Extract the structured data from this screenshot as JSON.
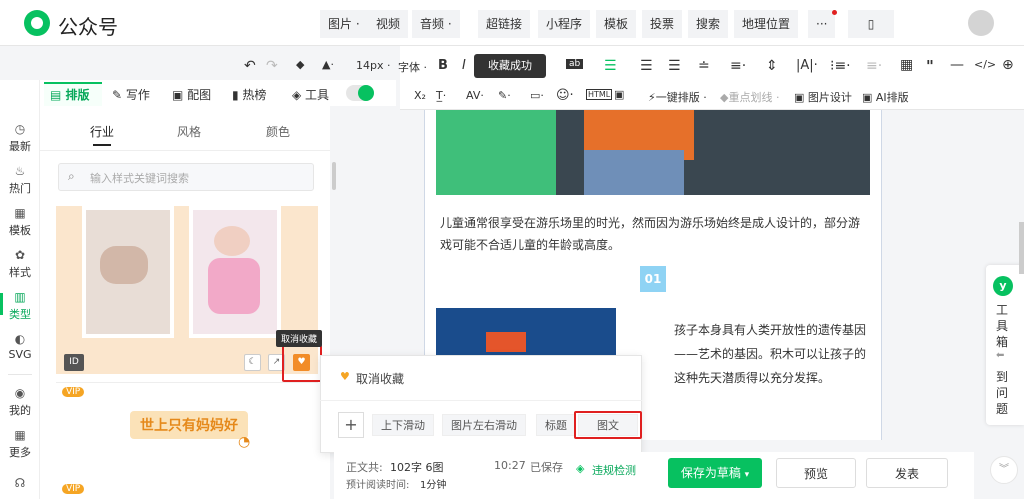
{
  "header": {
    "brand": "公众号"
  },
  "topnav": [
    "图片 ·",
    "视频",
    "音频 ·",
    "超链接",
    "小程序",
    "模板",
    "投票",
    "搜索",
    "地理位置",
    "···"
  ],
  "editor_toolbar": {
    "font_size": "14px ·",
    "font": "字体 ·",
    "bold": "B",
    "italic": "I",
    "one_click": "一键排版 ·",
    "highlight": "重点划线 ·",
    "pic_design": "图片设计",
    "ai_layout": "AI排版"
  },
  "toast": "收藏成功",
  "plugin_tabs": [
    "排版",
    "写作",
    "配图",
    "热榜",
    "工具"
  ],
  "left_nav": [
    "最新",
    "热门",
    "模板",
    "样式",
    "类型",
    "SVG",
    "我的",
    "更多"
  ],
  "sub_tabs": [
    "行业",
    "风格",
    "颜色"
  ],
  "search": {
    "placeholder": "输入样式关键词搜索"
  },
  "card": {
    "id_label": "ID",
    "tooltip": "取消收藏",
    "vip": "VIP",
    "banner_text": "世上只有妈妈好"
  },
  "popup": {
    "title": "取消收藏",
    "plus": "+",
    "actions": [
      "上下滑动",
      "图片左右滑动",
      "标题",
      "图文"
    ]
  },
  "article": {
    "para1": "儿童通常很享受在游乐场里的时光，然而因为游乐场始终是成人设计的，部分游戏可能不合适儿童的年龄或高度。",
    "number": "01",
    "para2": "孩子本身具有人类开放性的遗传基因——艺术的基因。积木可以让孩子的这种先天潜质得以充分发挥。"
  },
  "status": {
    "count_label": "正文共:",
    "count_value": "102字 6图",
    "read_label": "预计阅读时间:",
    "read_value": "1分钟",
    "saved_time": "10:27",
    "saved_label": "已保存",
    "check": "违规检测"
  },
  "buttons": {
    "save_draft": "保存为草稿",
    "preview": "预览",
    "publish": "发表"
  },
  "right_panel": {
    "tool": "工具箱",
    "q1": "到",
    "q2": "问",
    "q3": "题"
  },
  "colors": {
    "accent": "#07c160",
    "red": "#e02020",
    "num_bg": "#8fd3f4"
  }
}
